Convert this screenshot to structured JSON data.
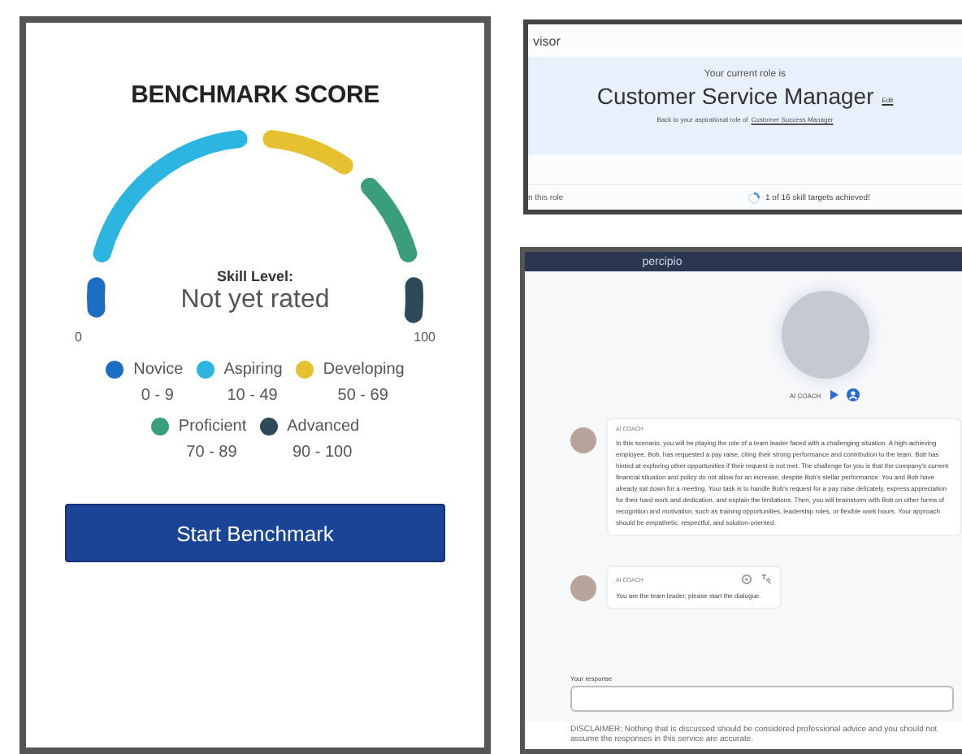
{
  "benchmark": {
    "title": "BENCHMARK SCORE",
    "skill_level_label": "Skill Level:",
    "skill_level": "Not yet rated",
    "scale_min": "0",
    "scale_max": "100",
    "levels": [
      {
        "name": "Novice",
        "range": "0 - 9",
        "color": "#1b6ec2"
      },
      {
        "name": "Aspiring",
        "range": "10 - 49",
        "color": "#2bb5e0"
      },
      {
        "name": "Developing",
        "range": "50 - 69",
        "color": "#e6c12f"
      },
      {
        "name": "Proficient",
        "range": "70 - 89",
        "color": "#3a9e7b"
      },
      {
        "name": "Advanced",
        "range": "90 - 100",
        "color": "#2c4a57"
      }
    ],
    "button": "Start Benchmark"
  },
  "role_panel": {
    "title": "visor",
    "intro": "Your current role is",
    "role": "Customer Service Manager",
    "edit_link": "Edit",
    "back_text": "Back to your aspirational role of",
    "back_link": "Customer Success Manager",
    "footer_left": "n this role",
    "progress": "1 of 16 skill targets achieved!"
  },
  "coach_panel": {
    "brand": "percipio",
    "coach_name": "AI COACH",
    "messages": [
      {
        "sender": "AI COACH",
        "text": "In this scenario, you will be playing the role of a team leader faced with a challenging situation. A high-achieving employee, Bob, has requested a pay raise, citing their strong performance and contribution to the team. Bob has hinted at exploring other opportunities if their request is not met. The challenge for you is that the company's current financial situation and policy do not allow for an increase, despite Bob's stellar performance. You and Bob have already sat down for a meeting. Your task is to handle Bob's request for a pay raise delicately, express appreciation for their hard work and dedication, and explain the limitations. Then, you will brainstorm with Bob on other forms of recognition and motivation, such as training opportunities, leadership roles, or flexible work hours. Your approach should be empathetic, respectful, and solution-oriented."
      },
      {
        "sender": "AI COACH",
        "text": "You are the team leader, please start the dialogue."
      }
    ],
    "response_label": "Your response",
    "disclaimer": "DISCLAIMER: Nothing that is discussed should be considered professional advice and you should not assume the responses in this service are accurate."
  }
}
